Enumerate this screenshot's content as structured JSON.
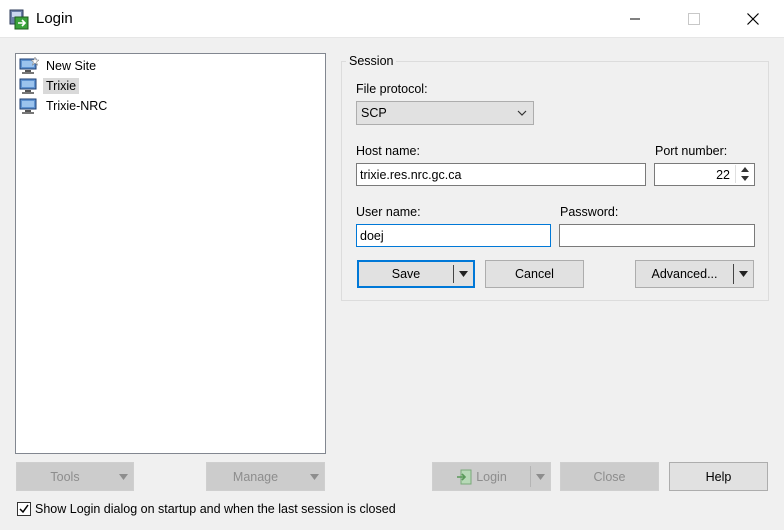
{
  "window": {
    "title": "Login"
  },
  "sites": {
    "items": [
      {
        "label": "New Site",
        "selected": false
      },
      {
        "label": "Trixie",
        "selected": true
      },
      {
        "label": "Trixie-NRC",
        "selected": false
      }
    ]
  },
  "session": {
    "group_label": "Session",
    "file_protocol_label": "File protocol:",
    "file_protocol_value": "SCP",
    "host_label": "Host name:",
    "host_value": "trixie.res.nrc.gc.ca",
    "port_label": "Port number:",
    "port_value": "22",
    "user_label": "User name:",
    "user_value": "doej",
    "password_label": "Password:",
    "password_value": ""
  },
  "buttons": {
    "save": "Save",
    "cancel": "Cancel",
    "advanced": "Advanced...",
    "tools": "Tools",
    "manage": "Manage",
    "login": "Login",
    "close": "Close",
    "help": "Help"
  },
  "options": {
    "show_login_label": "Show Login dialog on startup and when the last session is closed",
    "show_login_checked": true
  },
  "colors": {
    "accent": "#0078d7",
    "button_face": "#e1e1e1",
    "disabled_face": "#cccccc"
  }
}
